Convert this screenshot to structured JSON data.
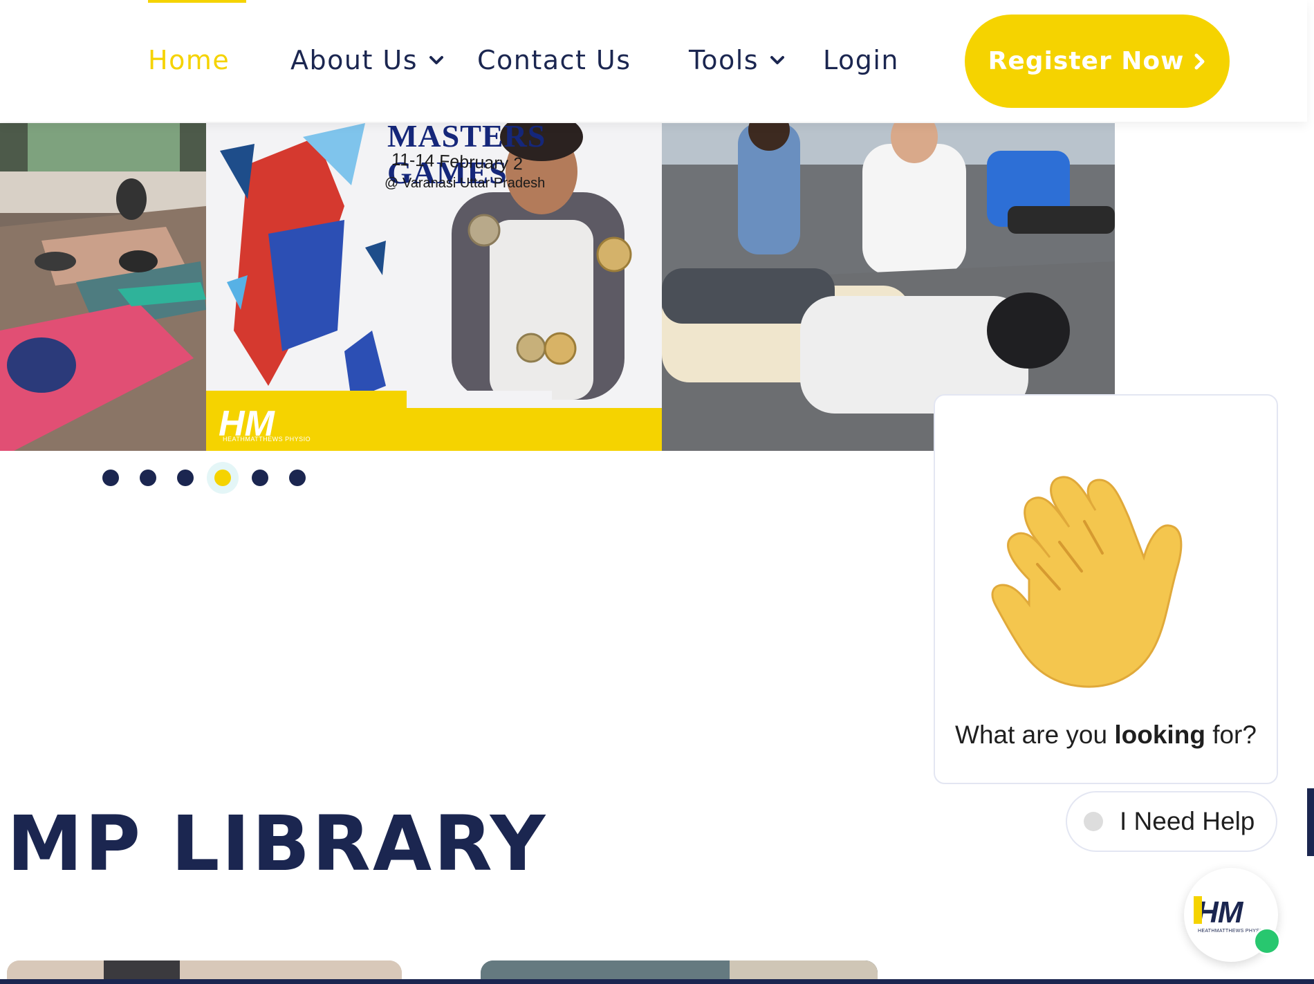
{
  "nav": {
    "home": "Home",
    "about": "About Us",
    "contact": "Contact Us",
    "tools": "Tools",
    "login": "Login",
    "register": "Register Now"
  },
  "carousel": {
    "slides": [
      {
        "name": "yoga-class-photo"
      },
      {
        "name": "masters-games-medal-photo",
        "poster_title": "MASTERS GAMES",
        "poster_date": "11-14 February 2",
        "poster_location": "@ Varanasi Uttar Pradesh",
        "logo_text": "HM",
        "logo_tagline": "HEATHMATTHEWS PHYSIO"
      },
      {
        "name": "physio-massage-photo"
      }
    ],
    "dot_count": 6,
    "active_dot": 4
  },
  "section": {
    "title": "MP LIBRARY"
  },
  "chat": {
    "message_prefix": "What are you ",
    "message_bold": "looking",
    "message_suffix": " for?",
    "help_button": "I Need Help",
    "launcher_logo": "HM",
    "launcher_tagline": "HEATHMATTHEWS PHYSIO"
  },
  "colors": {
    "brand_yellow": "#f5d300",
    "navy": "#1b2650",
    "online_green": "#28c76f"
  }
}
